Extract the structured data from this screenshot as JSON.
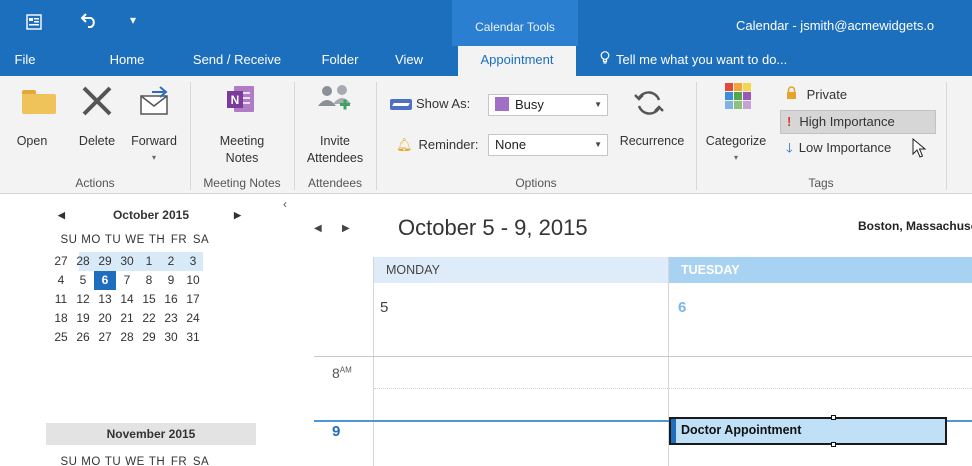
{
  "quick_access": {
    "icons": [
      "outlook-icon",
      "undo-icon",
      "customize-qat-icon"
    ]
  },
  "contextual_tab": "Calendar Tools",
  "window_title": "Calendar - jsmith@acmewidgets.o",
  "tabs": [
    {
      "label": "File"
    },
    {
      "label": "Home"
    },
    {
      "label": "Send / Receive"
    },
    {
      "label": "Folder"
    },
    {
      "label": "View"
    },
    {
      "label": "Appointment",
      "active": true
    }
  ],
  "tell_me": "Tell me what you want to do...",
  "ribbon": {
    "actions": {
      "open": "Open",
      "delete": "Delete",
      "forward": "Forward",
      "group": "Actions"
    },
    "meeting_notes": {
      "label_line1": "Meeting",
      "label_line2": "Notes",
      "group": "Meeting Notes"
    },
    "attendees": {
      "label_line1": "Invite",
      "label_line2": "Attendees",
      "group": "Attendees"
    },
    "options": {
      "show_as_label": "Show As:",
      "show_as_value": "Busy",
      "reminder_label": "Reminder:",
      "reminder_value": "None",
      "recurrence": "Recurrence",
      "group": "Options"
    },
    "tags": {
      "categorize": "Categorize",
      "private": "Private",
      "high_importance": "High Importance",
      "low_importance": "Low Importance",
      "group": "Tags"
    }
  },
  "mini_calendar": {
    "month1": "October 2015",
    "month2": "November 2015",
    "dow": [
      "SU",
      "MO",
      "TU",
      "WE",
      "TH",
      "FR",
      "SA"
    ],
    "weeks": [
      [
        "27",
        "28",
        "29",
        "30",
        "1",
        "2",
        "3"
      ],
      [
        "4",
        "5",
        "6",
        "7",
        "8",
        "9",
        "10"
      ],
      [
        "11",
        "12",
        "13",
        "14",
        "15",
        "16",
        "17"
      ],
      [
        "18",
        "19",
        "20",
        "21",
        "22",
        "23",
        "24"
      ],
      [
        "25",
        "26",
        "27",
        "28",
        "29",
        "30",
        "31"
      ]
    ],
    "today": "6"
  },
  "calendar": {
    "title": "October 5 - 9, 2015",
    "location": "Boston, Massachusetts",
    "days": [
      {
        "name": "MONDAY",
        "num": "5"
      },
      {
        "name": "TUESDAY",
        "num": "6"
      }
    ],
    "time_8": "8",
    "time_8_suffix": "AM",
    "time_9": "9",
    "appointment": "Doctor Appointment"
  }
}
